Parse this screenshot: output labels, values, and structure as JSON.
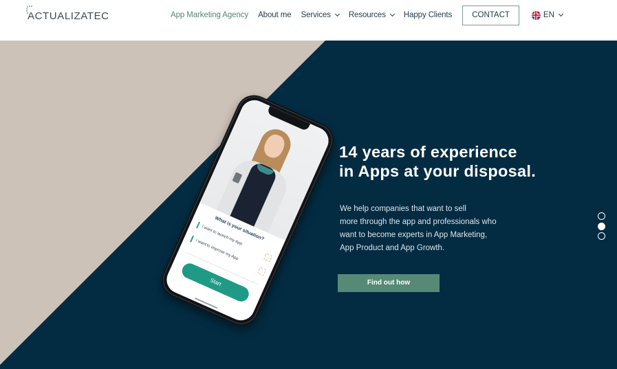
{
  "header": {
    "logo_text": "ACTUALIZATEC",
    "nav": [
      {
        "label": "App Marketing Agency",
        "active": true,
        "has_dropdown": false
      },
      {
        "label": "About me",
        "active": false,
        "has_dropdown": false
      },
      {
        "label": "Services",
        "active": false,
        "has_dropdown": true
      },
      {
        "label": "Resources",
        "active": false,
        "has_dropdown": true
      },
      {
        "label": "Happy Clients",
        "active": false,
        "has_dropdown": false
      }
    ],
    "contact_label": "CONTACT",
    "language": {
      "label": "EN",
      "icon": "uk-flag-icon"
    }
  },
  "hero": {
    "title_lines": [
      "14 years of experience",
      "in Apps at your disposal."
    ],
    "description_lines": [
      "We help companies that want to sell",
      "more through the app and professionals who",
      "want to become experts in App Marketing,",
      "App Product and App Growth."
    ],
    "cta_label": "Find out how",
    "phone_mockup": {
      "quiz_title": "What is your situation?",
      "options": [
        "I want to launch my App",
        "I want to improve my App"
      ],
      "start_label": "Start"
    },
    "slider": {
      "total": 3,
      "active_index": 1
    }
  },
  "colors": {
    "navy": "#032c43",
    "beige": "#cdc2b8",
    "accent_green": "#568a76",
    "nav_active": "#4f8a76",
    "start_teal": "#1f9a86"
  }
}
